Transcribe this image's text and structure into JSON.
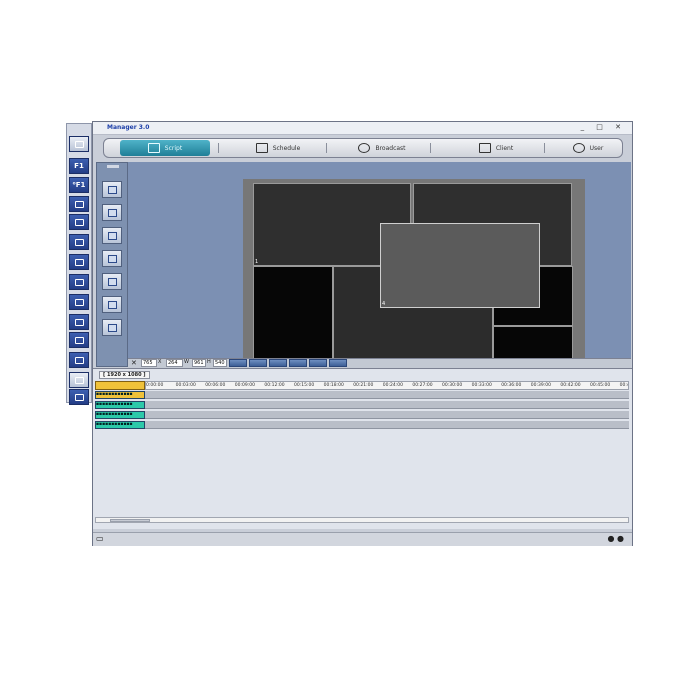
{
  "window": {
    "title": "Manager 3.0",
    "controls": "_ □ ✕"
  },
  "palette": {
    "items": [
      {
        "icon": "window-icon",
        "label": ""
      },
      {
        "icon": "text-icon",
        "label": "F1"
      },
      {
        "icon": "text-effect-icon",
        "label": "⁰F1"
      },
      {
        "icon": "tv-icon",
        "label": ""
      },
      {
        "icon": "flash-icon",
        "label": ""
      },
      {
        "icon": "ticker-icon",
        "label": ""
      },
      {
        "icon": "rss-icon",
        "label": ""
      },
      {
        "icon": "weather-icon",
        "label": ""
      },
      {
        "icon": "grid-icon",
        "label": ""
      },
      {
        "icon": "list-icon",
        "label": ""
      },
      {
        "icon": "arrow-up-icon",
        "label": ""
      },
      {
        "icon": "arrow-down-icon",
        "label": ""
      },
      {
        "icon": "settings-icon",
        "label": ""
      },
      {
        "icon": "tools-icon",
        "label": ""
      }
    ]
  },
  "tabs": [
    {
      "label": "Script",
      "icon": "script-icon",
      "active": true
    },
    {
      "label": "Schedule",
      "icon": "calendar-icon",
      "active": false
    },
    {
      "label": "Broadcast",
      "icon": "broadcast-icon",
      "active": false
    },
    {
      "label": "Client",
      "icon": "monitor-icon",
      "active": false
    },
    {
      "label": "User",
      "icon": "user-icon",
      "active": false
    }
  ],
  "tools": [
    "frame-icon",
    "grid-icon",
    "camera-icon",
    "save-icon",
    "page-icon",
    "layout-icon",
    "check-icon"
  ],
  "stage": {
    "zones": [
      {
        "label": "1"
      },
      {
        "label": ""
      },
      {
        "label": "1"
      },
      {
        "label": "1"
      },
      {
        "label": ""
      },
      {
        "label": "1"
      },
      {
        "label": "4"
      }
    ]
  },
  "coords": {
    "close": "✕",
    "x": "765",
    "x_unit": "X",
    "y": "264",
    "y_unit": "W",
    "w": "961",
    "w_unit": "H",
    "h": "540"
  },
  "timeline": {
    "resolution": "[ 1920 x 1080 ]",
    "ticks": [
      "0:00:00",
      "00:03:00",
      "00:06:00",
      "00:09:00",
      "00:12:00",
      "00:15:00",
      "00:18:00",
      "00:21:00",
      "00:24:00",
      "00:27:00",
      "00:30:00",
      "00:33:00",
      "00:36:00",
      "00:39:00",
      "00:42:00",
      "00:45:00",
      "00:48"
    ],
    "tracks": [
      {
        "label": "▪▪▪▪▪▪▪▪▪▪▪▪",
        "color": "#f0c23a"
      },
      {
        "label": "▪▪▪▪▪▪▪▪▪▪▪▪",
        "color": "#2cc9a9"
      },
      {
        "label": "▪▪▪▪▪▪▪▪▪▪▪▪",
        "color": "#2cc9a9"
      },
      {
        "label": "▪▪▪▪▪▪▪▪▪▪▪▪",
        "color": "#2cc9a9"
      }
    ]
  },
  "statusbar": {
    "left": "▭",
    "right": "● ●"
  }
}
